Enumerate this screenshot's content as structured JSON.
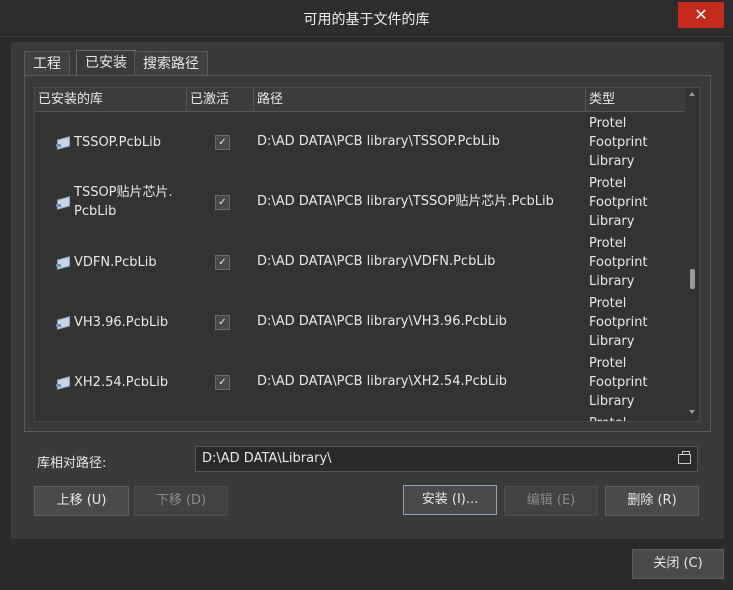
{
  "window": {
    "title": "可用的基于文件的库",
    "close_symbol": "✕"
  },
  "tabs": [
    {
      "label": "工程",
      "active": false
    },
    {
      "label": "已安装",
      "active": true
    },
    {
      "label": "搜索路径",
      "active": false
    }
  ],
  "table": {
    "columns": [
      "已安装的库",
      "已激活",
      "路径",
      "类型"
    ],
    "rows": [
      {
        "name_line1": "TSSOP.PcbLib",
        "name_line2": "",
        "active": true,
        "path": "D:\\AD DATA\\PCB library\\TSSOP.PcbLib",
        "type": [
          "Protel",
          "Footprint",
          "Library"
        ]
      },
      {
        "name_line1": "TSSOP贴片芯片.",
        "name_line2": "PcbLib",
        "active": true,
        "path": "D:\\AD DATA\\PCB library\\TSSOP贴片芯片.PcbLib",
        "type": [
          "Protel",
          "Footprint",
          "Library"
        ]
      },
      {
        "name_line1": "VDFN.PcbLib",
        "name_line2": "",
        "active": true,
        "path": "D:\\AD DATA\\PCB library\\VDFN.PcbLib",
        "type": [
          "Protel",
          "Footprint",
          "Library"
        ]
      },
      {
        "name_line1": "VH3.96.PcbLib",
        "name_line2": "",
        "active": true,
        "path": "D:\\AD DATA\\PCB library\\VH3.96.PcbLib",
        "type": [
          "Protel",
          "Footprint",
          "Library"
        ]
      },
      {
        "name_line1": "XH2.54.PcbLib",
        "name_line2": "",
        "active": true,
        "path": "D:\\AD DATA\\PCB library\\XH2.54.PcbLib",
        "type": [
          "Protel",
          "Footprint",
          "Library"
        ]
      }
    ],
    "check_mark": "✓",
    "partial_next_type": "Protel"
  },
  "relative_path": {
    "label": "库相对路径:",
    "value": "D:\\AD DATA\\Library\\"
  },
  "buttons": {
    "move_up": "上移 (U)",
    "move_down": "下移 (D)",
    "install": "安装 (I)...",
    "edit": "编辑 (E)",
    "remove": "删除 (R)",
    "close": "关闭 (C)"
  },
  "colors": {
    "close_button": "#c42b1c",
    "focus_border": "#8fa6bf"
  }
}
